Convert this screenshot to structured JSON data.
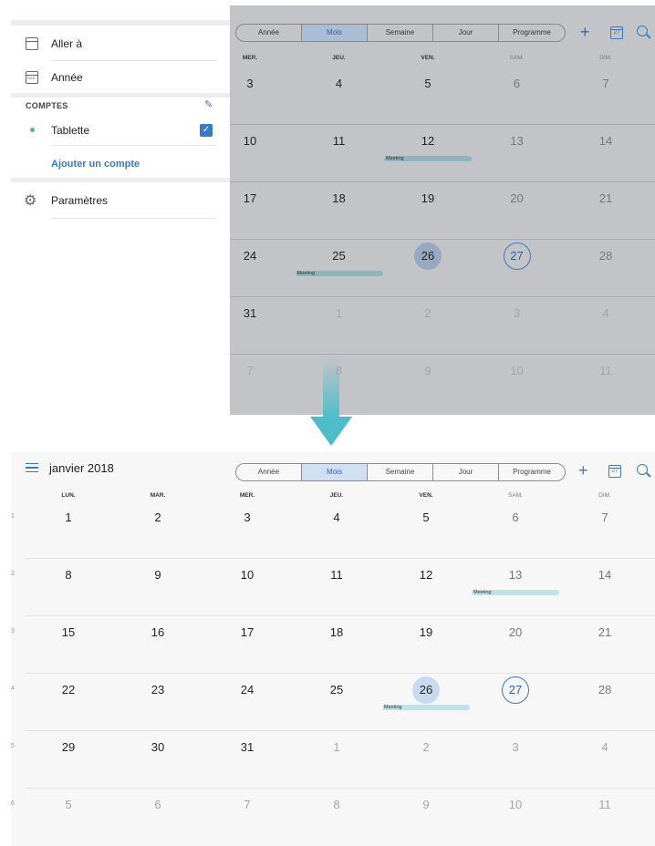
{
  "drawer": {
    "goto_label": "Aller à",
    "year_label": "Année",
    "accounts_section": "COMPTES",
    "account_name": "Tablette",
    "add_account": "Ajouter un compte",
    "settings_label": "Paramètres",
    "year_icon_text": "2018"
  },
  "view_tabs": [
    "Année",
    "Mois",
    "Semaine",
    "Jour",
    "Programme"
  ],
  "active_tab": "Mois",
  "calendar_icon_day": "27",
  "top_calendar": {
    "weekdays": [
      "MER.",
      "JEU.",
      "VEN.",
      "SAM.",
      "DIM."
    ],
    "rows": [
      [
        "3",
        "4",
        "5",
        "6",
        "7"
      ],
      [
        "10",
        "11",
        "12",
        "13",
        "14"
      ],
      [
        "17",
        "18",
        "19",
        "20",
        "21"
      ],
      [
        "24",
        "25",
        "26",
        "27",
        "28"
      ],
      [
        "31",
        "1",
        "2",
        "3",
        "4"
      ],
      [
        "7",
        "8",
        "9",
        "10",
        "11"
      ]
    ],
    "events": [
      {
        "label": "Meeting",
        "row": 1,
        "col": 2
      },
      {
        "label": "Meeting",
        "row": 3,
        "col": 1
      }
    ]
  },
  "bottom_calendar": {
    "month_title": "janvier 2018",
    "weekdays": [
      "LUN.",
      "MAR.",
      "MER.",
      "JEU.",
      "VEN.",
      "SAM.",
      "DIM."
    ],
    "week_numbers": [
      "1",
      "2",
      "3",
      "4",
      "5",
      "6"
    ],
    "rows": [
      [
        "1",
        "2",
        "3",
        "4",
        "5",
        "6",
        "7"
      ],
      [
        "8",
        "9",
        "10",
        "11",
        "12",
        "13",
        "14"
      ],
      [
        "15",
        "16",
        "17",
        "18",
        "19",
        "20",
        "21"
      ],
      [
        "22",
        "23",
        "24",
        "25",
        "26",
        "27",
        "28"
      ],
      [
        "29",
        "30",
        "31",
        "1",
        "2",
        "3",
        "4"
      ],
      [
        "5",
        "6",
        "7",
        "8",
        "9",
        "10",
        "11"
      ]
    ],
    "events": [
      {
        "label": "Meeting",
        "row": 1,
        "col": 5
      },
      {
        "label": "Meeting",
        "row": 3,
        "col": 4
      }
    ]
  },
  "colors": {
    "accent": "#3a78c8",
    "event_bar": "#bfe3ea",
    "event_bar_dim": "#8eb4bd",
    "selected_day": "#c8daf0",
    "selected_day_dim": "#97a9c0",
    "arrow": "#4dbec9"
  }
}
